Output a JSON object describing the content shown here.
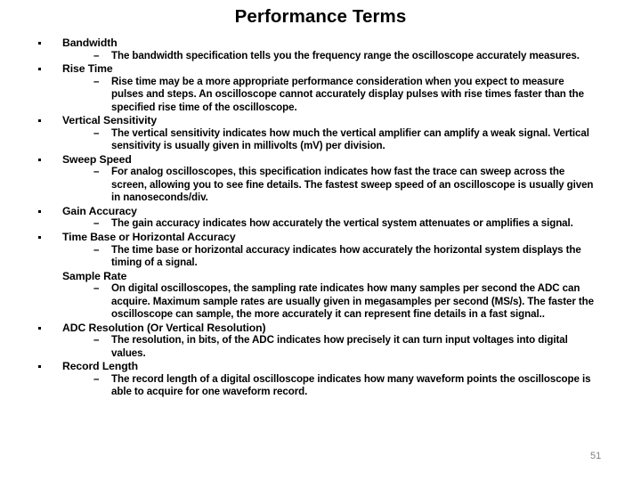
{
  "slide": {
    "title": "Performance Terms",
    "page_number": "51",
    "page_number_color": "#808080",
    "text_color": "#000000",
    "background_color": "#ffffff",
    "dash_glyph": "–",
    "items": [
      {
        "level1": "Bandwidth",
        "bulleted": true,
        "level2": "The bandwidth specification tells you the frequency range the oscilloscope accurately measures."
      },
      {
        "level1": "Rise Time",
        "bulleted": true,
        "level2": "Rise time may be a more appropriate performance consideration when you expect to measure pulses and steps. An oscilloscope cannot accurately display pulses with rise times faster than the specified rise time of the oscilloscope."
      },
      {
        "level1": "Vertical Sensitivity",
        "bulleted": true,
        "level2": "The vertical sensitivity indicates how much the vertical amplifier can amplify a weak signal. Vertical sensitivity is usually given in millivolts (mV) per division."
      },
      {
        "level1": "Sweep Speed",
        "bulleted": true,
        "level2": "For analog oscilloscopes, this specification indicates how fast the trace can sweep across the screen, allowing you to see fine details. The fastest sweep speed of an oscilloscope is usually given in nanoseconds/div."
      },
      {
        "level1": "Gain Accuracy",
        "bulleted": true,
        "level2": "The gain accuracy indicates how accurately the vertical system attenuates or amplifies a signal."
      },
      {
        "level1": "Time Base or Horizontal Accuracy",
        "bulleted": true,
        "level2": "The time base or horizontal accuracy indicates how accurately the horizontal system displays the timing of a signal."
      },
      {
        "level1": "Sample Rate",
        "bulleted": false,
        "level2": "On digital oscilloscopes, the sampling rate indicates how many samples per second the ADC can acquire. Maximum sample rates are usually given in megasamples per second (MS/s). The faster the oscilloscope can sample, the more accurately it can represent fine details in a fast signal.."
      },
      {
        "level1": "ADC Resolution (Or Vertical Resolution)",
        "bulleted": true,
        "level2": "The resolution, in bits, of the ADC indicates how precisely it can turn input voltages into digital values."
      },
      {
        "level1": "Record Length",
        "bulleted": true,
        "level2": "The record length of a digital oscilloscope indicates how many waveform points the oscilloscope is able to acquire for one waveform record."
      }
    ]
  }
}
